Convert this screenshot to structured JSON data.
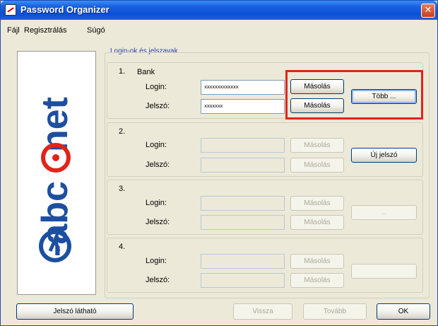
{
  "window": {
    "title": "Password Organizer",
    "close_glyph": "✕"
  },
  "menu": [
    "Fájl",
    "Regisztrálás",
    "Súgó"
  ],
  "logo_text": "1-abc.net",
  "group_title": "Login-ok és jelszavak",
  "entries": [
    {
      "num": "1.",
      "name": "Bank",
      "login_label": "Login:",
      "password_label": "Jelszó:",
      "login_value": "xxxxxxxxxxxxx",
      "password_value": "xxxxxxx",
      "copy_login": "Másolás",
      "copy_password": "Másolás",
      "side_button": "Több ..."
    },
    {
      "num": "2.",
      "login_label": "Login:",
      "password_label": "Jelszó:",
      "copy_login": "Másolás",
      "copy_password": "Másolás",
      "side_button": "Új jelszó"
    },
    {
      "num": "3.",
      "login_label": "Login:",
      "password_label": "Jelszó:",
      "copy_login": "Másolás",
      "copy_password": "Másolás",
      "side_button": "..."
    },
    {
      "num": "4.",
      "login_label": "Login:",
      "password_label": "Jelszó:",
      "copy_login": "Másolás",
      "copy_password": "Másolás",
      "side_button": ""
    }
  ],
  "footer": {
    "show_password": "Jelszó látható",
    "back": "Vissza",
    "next": "Tovább",
    "ok": "OK"
  },
  "colors": {
    "title_blue": "#0a4fd6",
    "highlight_red": "#e2231a",
    "logo_blue": "#1d4fa0",
    "logo_red": "#e2231a"
  }
}
